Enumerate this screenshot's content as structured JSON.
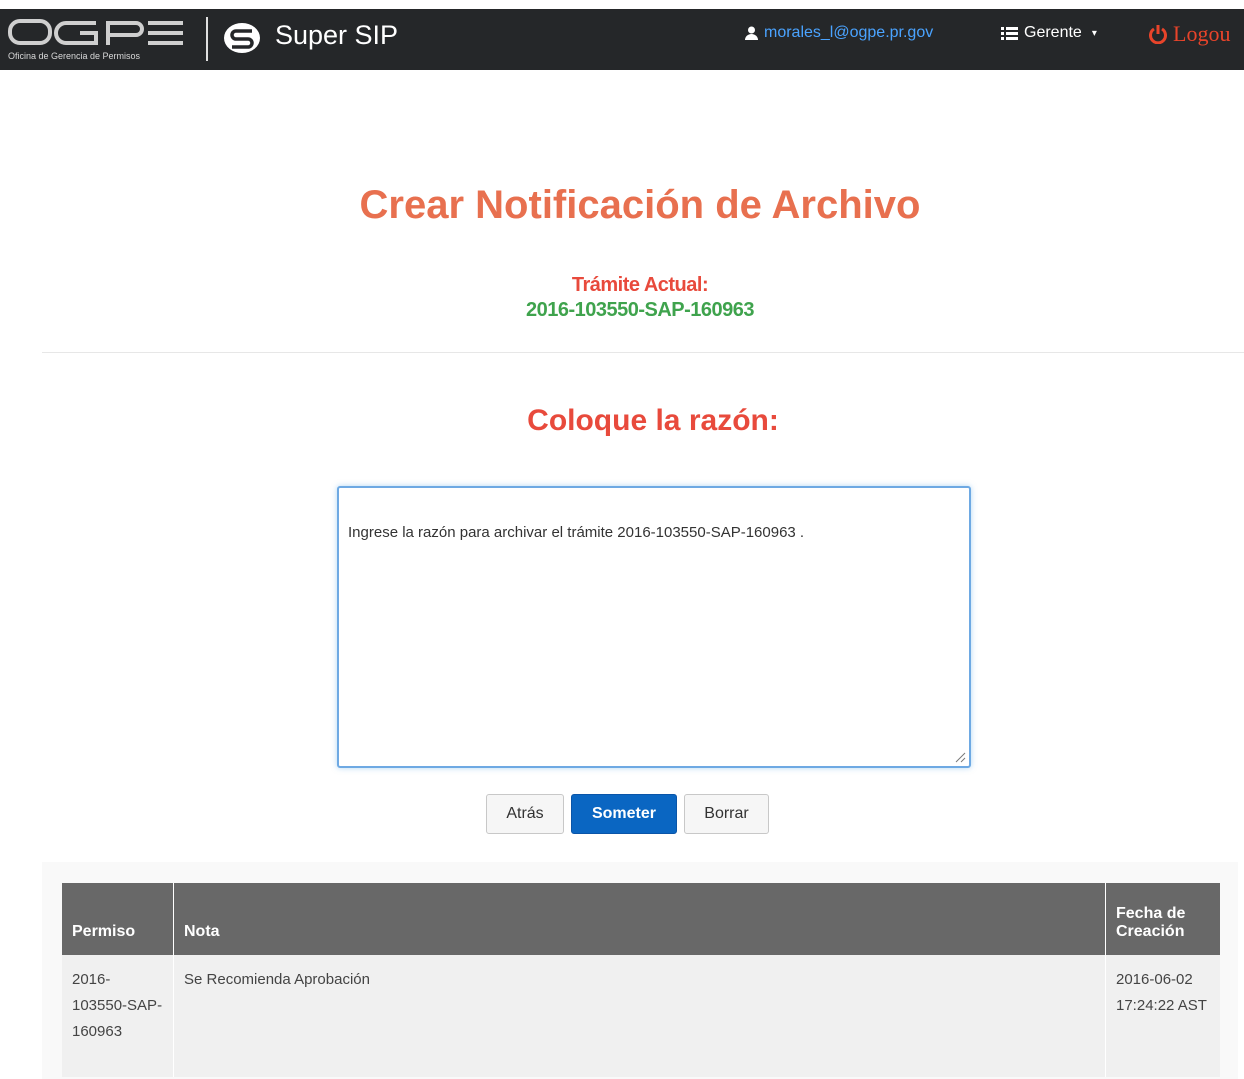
{
  "navbar": {
    "logo_letters": "OGPE",
    "logo_subtitle": "Oficina de Gerencia de Permisos",
    "brand_name": "Super SIP",
    "user_email": "morales_l@ogpe.pr.gov",
    "role_label": "Gerente",
    "logout_label": "Logou"
  },
  "main": {
    "title": "Crear Notificación de Archivo",
    "tramite_label": "Trámite Actual:",
    "tramite_value": "2016-103550-SAP-160963",
    "reason_heading": "Coloque la razón:",
    "reason_text": "Ingrese la razón para archivar el trámite 2016-103550-SAP-160963 .",
    "buttons": {
      "back": "Atrás",
      "submit": "Someter",
      "clear": "Borrar"
    }
  },
  "table": {
    "headers": {
      "permiso": "Permiso",
      "nota": "Nota",
      "fecha": "Fecha de Creación"
    },
    "rows": [
      {
        "permiso": "2016-103550-SAP-160963",
        "nota": "Se Recomienda Aprobación",
        "fecha": "2016-06-02 17:24:22 AST"
      }
    ]
  },
  "colors": {
    "navbar_bg": "#252729",
    "title": "#e8704f",
    "accent_red": "#e84a3c",
    "tramite_green": "#3fa34d",
    "primary_button": "#0a66c2",
    "link_blue": "#4aa3ff"
  },
  "icons": [
    "user-icon",
    "list-icon",
    "caret-down-icon",
    "power-icon",
    "brand-s-icon",
    "resize-grip-icon"
  ]
}
